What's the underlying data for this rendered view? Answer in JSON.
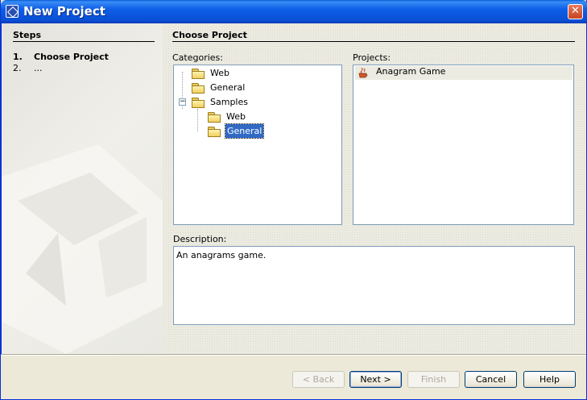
{
  "window": {
    "title": "New Project"
  },
  "steps": {
    "heading": "Steps",
    "items": [
      {
        "number": "1.",
        "label": "Choose Project"
      },
      {
        "number": "2.",
        "label": "..."
      }
    ]
  },
  "main": {
    "heading": "Choose Project",
    "categories_label": "Categories:",
    "projects_label": "Projects:",
    "description_label": "Description:",
    "categories": [
      {
        "label": "Web",
        "level": 0
      },
      {
        "label": "General",
        "level": 0
      },
      {
        "label": "Samples",
        "level": 0,
        "expanded": true
      },
      {
        "label": "Web",
        "level": 1
      },
      {
        "label": "General",
        "level": 1,
        "selected": true
      }
    ],
    "projects": [
      {
        "label": "Anagram Game",
        "icon": "java-cup-icon"
      }
    ],
    "description": "An anagrams game.",
    "expander_symbol": "−"
  },
  "buttons": {
    "back": "< Back",
    "next": "Next >",
    "finish": "Finish",
    "cancel": "Cancel",
    "help": "Help"
  },
  "close_glyph": "✕",
  "colors": {
    "titlebar": "#0a4fd4",
    "selection": "#316ac5",
    "background": "#ece9d8"
  }
}
